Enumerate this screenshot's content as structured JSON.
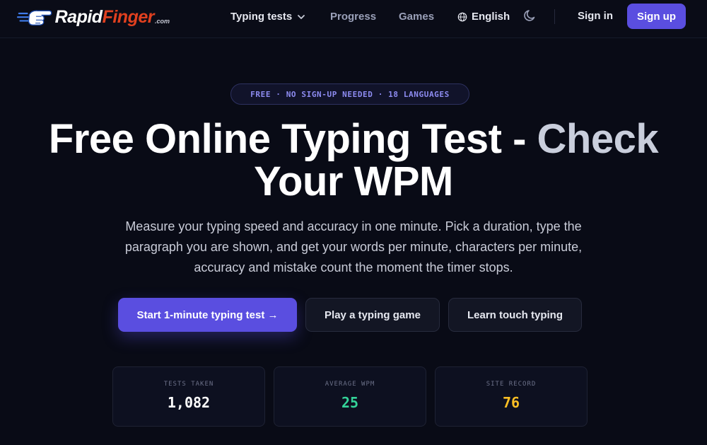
{
  "header": {
    "logo": {
      "part1": "Rapid",
      "part2": "Finger",
      "suffix": ".com"
    },
    "nav": [
      {
        "label": "Typing tests"
      },
      {
        "label": "Progress"
      },
      {
        "label": "Games"
      }
    ],
    "language": "English",
    "signin_label": "Sign in",
    "signup_label": "Sign up"
  },
  "hero": {
    "pill": "FREE · NO SIGN-UP NEEDED · 18 LANGUAGES",
    "title_main": "Free Online Typing Test - ",
    "title_accent": "Check",
    "title_line2": "Your WPM",
    "subtitle": "Measure your typing speed and accuracy in one minute. Pick a duration, type the paragraph you are shown, and get your words per minute, characters per minute, accuracy and mistake count the moment the timer stops."
  },
  "cta": {
    "primary": "Start 1-minute typing test →",
    "game": "Play a typing game",
    "learn": "Learn touch typing"
  },
  "stats": [
    {
      "label": "TESTS TAKEN",
      "value": "1,082",
      "color": "#ffffff"
    },
    {
      "label": "AVERAGE WPM",
      "value": "25",
      "color": "#34d399"
    },
    {
      "label": "SITE RECORD",
      "value": "76",
      "color": "#fbbf24"
    }
  ],
  "colors": {
    "accent": "#5a4ee0",
    "background": "#090b16"
  }
}
